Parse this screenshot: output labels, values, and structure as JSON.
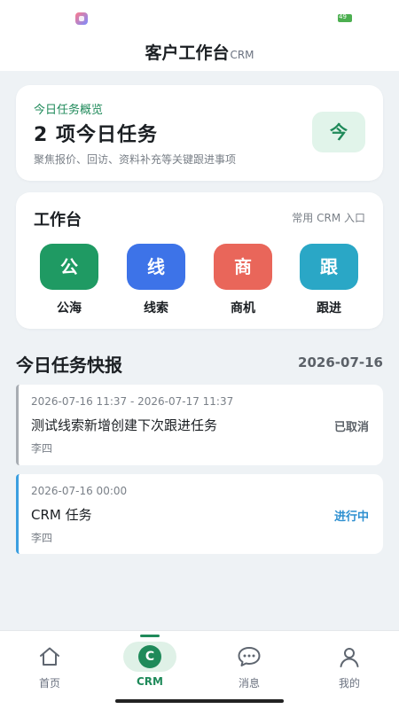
{
  "status_bar": {
    "battery_label": "49"
  },
  "header": {
    "title": "客户工作台",
    "subtitle": "CRM"
  },
  "overview": {
    "label": "今日任务概览",
    "count_text": "2 项今日任务",
    "description": "聚焦报价、回访、资料补充等关键跟进事项",
    "badge": "今"
  },
  "workbench": {
    "title": "工作台",
    "hint": "常用 CRM 入口",
    "items": [
      {
        "glyph": "公",
        "label": "公海",
        "color": "#1f9a63"
      },
      {
        "glyph": "线",
        "label": "线索",
        "color": "#3d73e8"
      },
      {
        "glyph": "商",
        "label": "商机",
        "color": "#e9665a"
      },
      {
        "glyph": "跟",
        "label": "跟进",
        "color": "#2aa7c6"
      }
    ]
  },
  "tasks_section": {
    "title": "今日任务快报",
    "date": "2026-07-16"
  },
  "tasks": [
    {
      "time": "2026-07-16 11:37 - 2026-07-17 11:37",
      "name": "测试线索新增创建下次跟进任务",
      "owner": "李四",
      "status": "已取消"
    },
    {
      "time": "2026-07-16 00:00",
      "name": "CRM 任务",
      "owner": "李四",
      "status": "进行中"
    }
  ],
  "nav": {
    "items": [
      {
        "label": "首页",
        "icon": "home-icon"
      },
      {
        "label": "CRM",
        "icon": "crm-icon",
        "glyph": "C"
      },
      {
        "label": "消息",
        "icon": "message-icon"
      },
      {
        "label": "我的",
        "icon": "profile-icon"
      }
    ],
    "active": "CRM",
    "accent": "#1f8a5a"
  }
}
